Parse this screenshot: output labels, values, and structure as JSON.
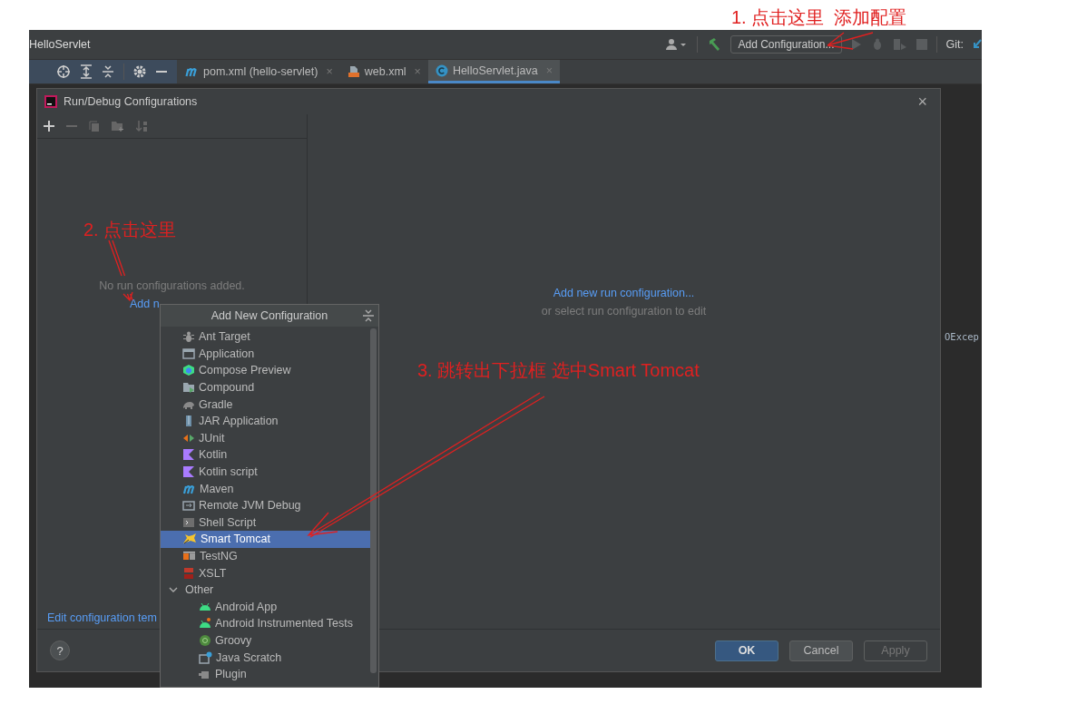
{
  "window": {
    "title": "HelloServlet"
  },
  "toolbar": {
    "config_button": "Add Configuration...",
    "vcs_label": "Git:"
  },
  "tabs": [
    {
      "label": "pom.xml (hello-servlet)",
      "selected": false,
      "close": "×"
    },
    {
      "label": "web.xml",
      "selected": false,
      "close": "×"
    },
    {
      "label": "HelloServlet.java",
      "selected": true,
      "close": "×"
    }
  ],
  "editor": {
    "visible_code": "OExcep"
  },
  "dialog": {
    "title": "Run/Debug Configurations",
    "close": "×",
    "empty_message": "No run configurations added.",
    "add_link": "Add n",
    "templates_link": "Edit configuration tem",
    "right_link": "Add new run configuration...",
    "right_hint": "or select run configuration to edit",
    "help": "?",
    "buttons": [
      {
        "label": "OK",
        "kind": "primary",
        "disabled": false
      },
      {
        "label": "Cancel",
        "kind": "normal",
        "disabled": false
      },
      {
        "label": "Apply",
        "kind": "normal",
        "disabled": true
      }
    ]
  },
  "popup": {
    "title": "Add New Configuration",
    "items": [
      {
        "label": "Ant Target",
        "selected": false
      },
      {
        "label": "Application",
        "selected": false
      },
      {
        "label": "Compose Preview",
        "selected": false
      },
      {
        "label": "Compound",
        "selected": false
      },
      {
        "label": "Gradle",
        "selected": false
      },
      {
        "label": "JAR Application",
        "selected": false
      },
      {
        "label": "JUnit",
        "selected": false
      },
      {
        "label": "Kotlin",
        "selected": false
      },
      {
        "label": "Kotlin script",
        "selected": false
      },
      {
        "label": "Maven",
        "selected": false
      },
      {
        "label": "Remote JVM Debug",
        "selected": false
      },
      {
        "label": "Shell Script",
        "selected": false
      },
      {
        "label": "Smart Tomcat",
        "selected": true
      },
      {
        "label": "TestNG",
        "selected": false
      },
      {
        "label": "XSLT",
        "selected": false
      },
      {
        "label": "Other",
        "selected": false,
        "expanded": true,
        "children": [
          {
            "label": "Android App",
            "selected": false
          },
          {
            "label": "Android Instrumented Tests",
            "selected": false
          },
          {
            "label": "Groovy",
            "selected": false
          },
          {
            "label": "Java Scratch",
            "selected": false
          },
          {
            "label": "Plugin",
            "selected": false
          }
        ]
      }
    ]
  },
  "annotations": [
    "1. 点击这里  添加配置",
    "2. 点击这里",
    "3. 跳转出下拉框 选中Smart Tomcat"
  ]
}
